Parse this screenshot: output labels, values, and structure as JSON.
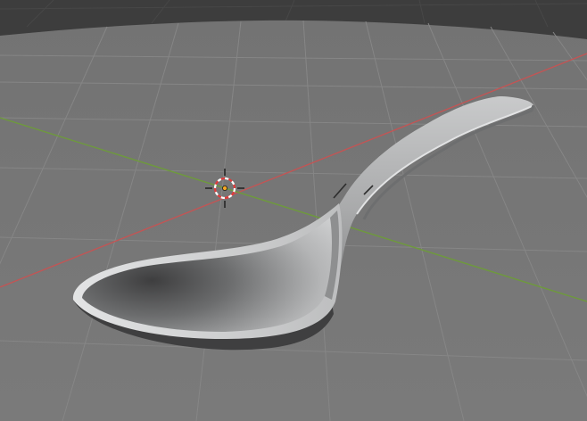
{
  "viewport": {
    "colors": {
      "background": "#3d3d3d",
      "ground_plane": "#777777",
      "grid_line": "#858585",
      "x_axis": "#c25555",
      "y_axis": "#6e9a3c",
      "mesh_light": "#d0d1d2",
      "mesh_mid": "#a5a6a7",
      "mesh_dark": "#4b4b4c",
      "cursor_ring": "#ffffff",
      "cursor_ring_alt": "#e23b3b",
      "cursor_center": "#f5a623"
    },
    "objects": [
      {
        "kind": "mesh",
        "icon": "spoon-mesh"
      },
      {
        "kind": "3d-cursor",
        "icon": "crosshair-icon"
      }
    ]
  }
}
